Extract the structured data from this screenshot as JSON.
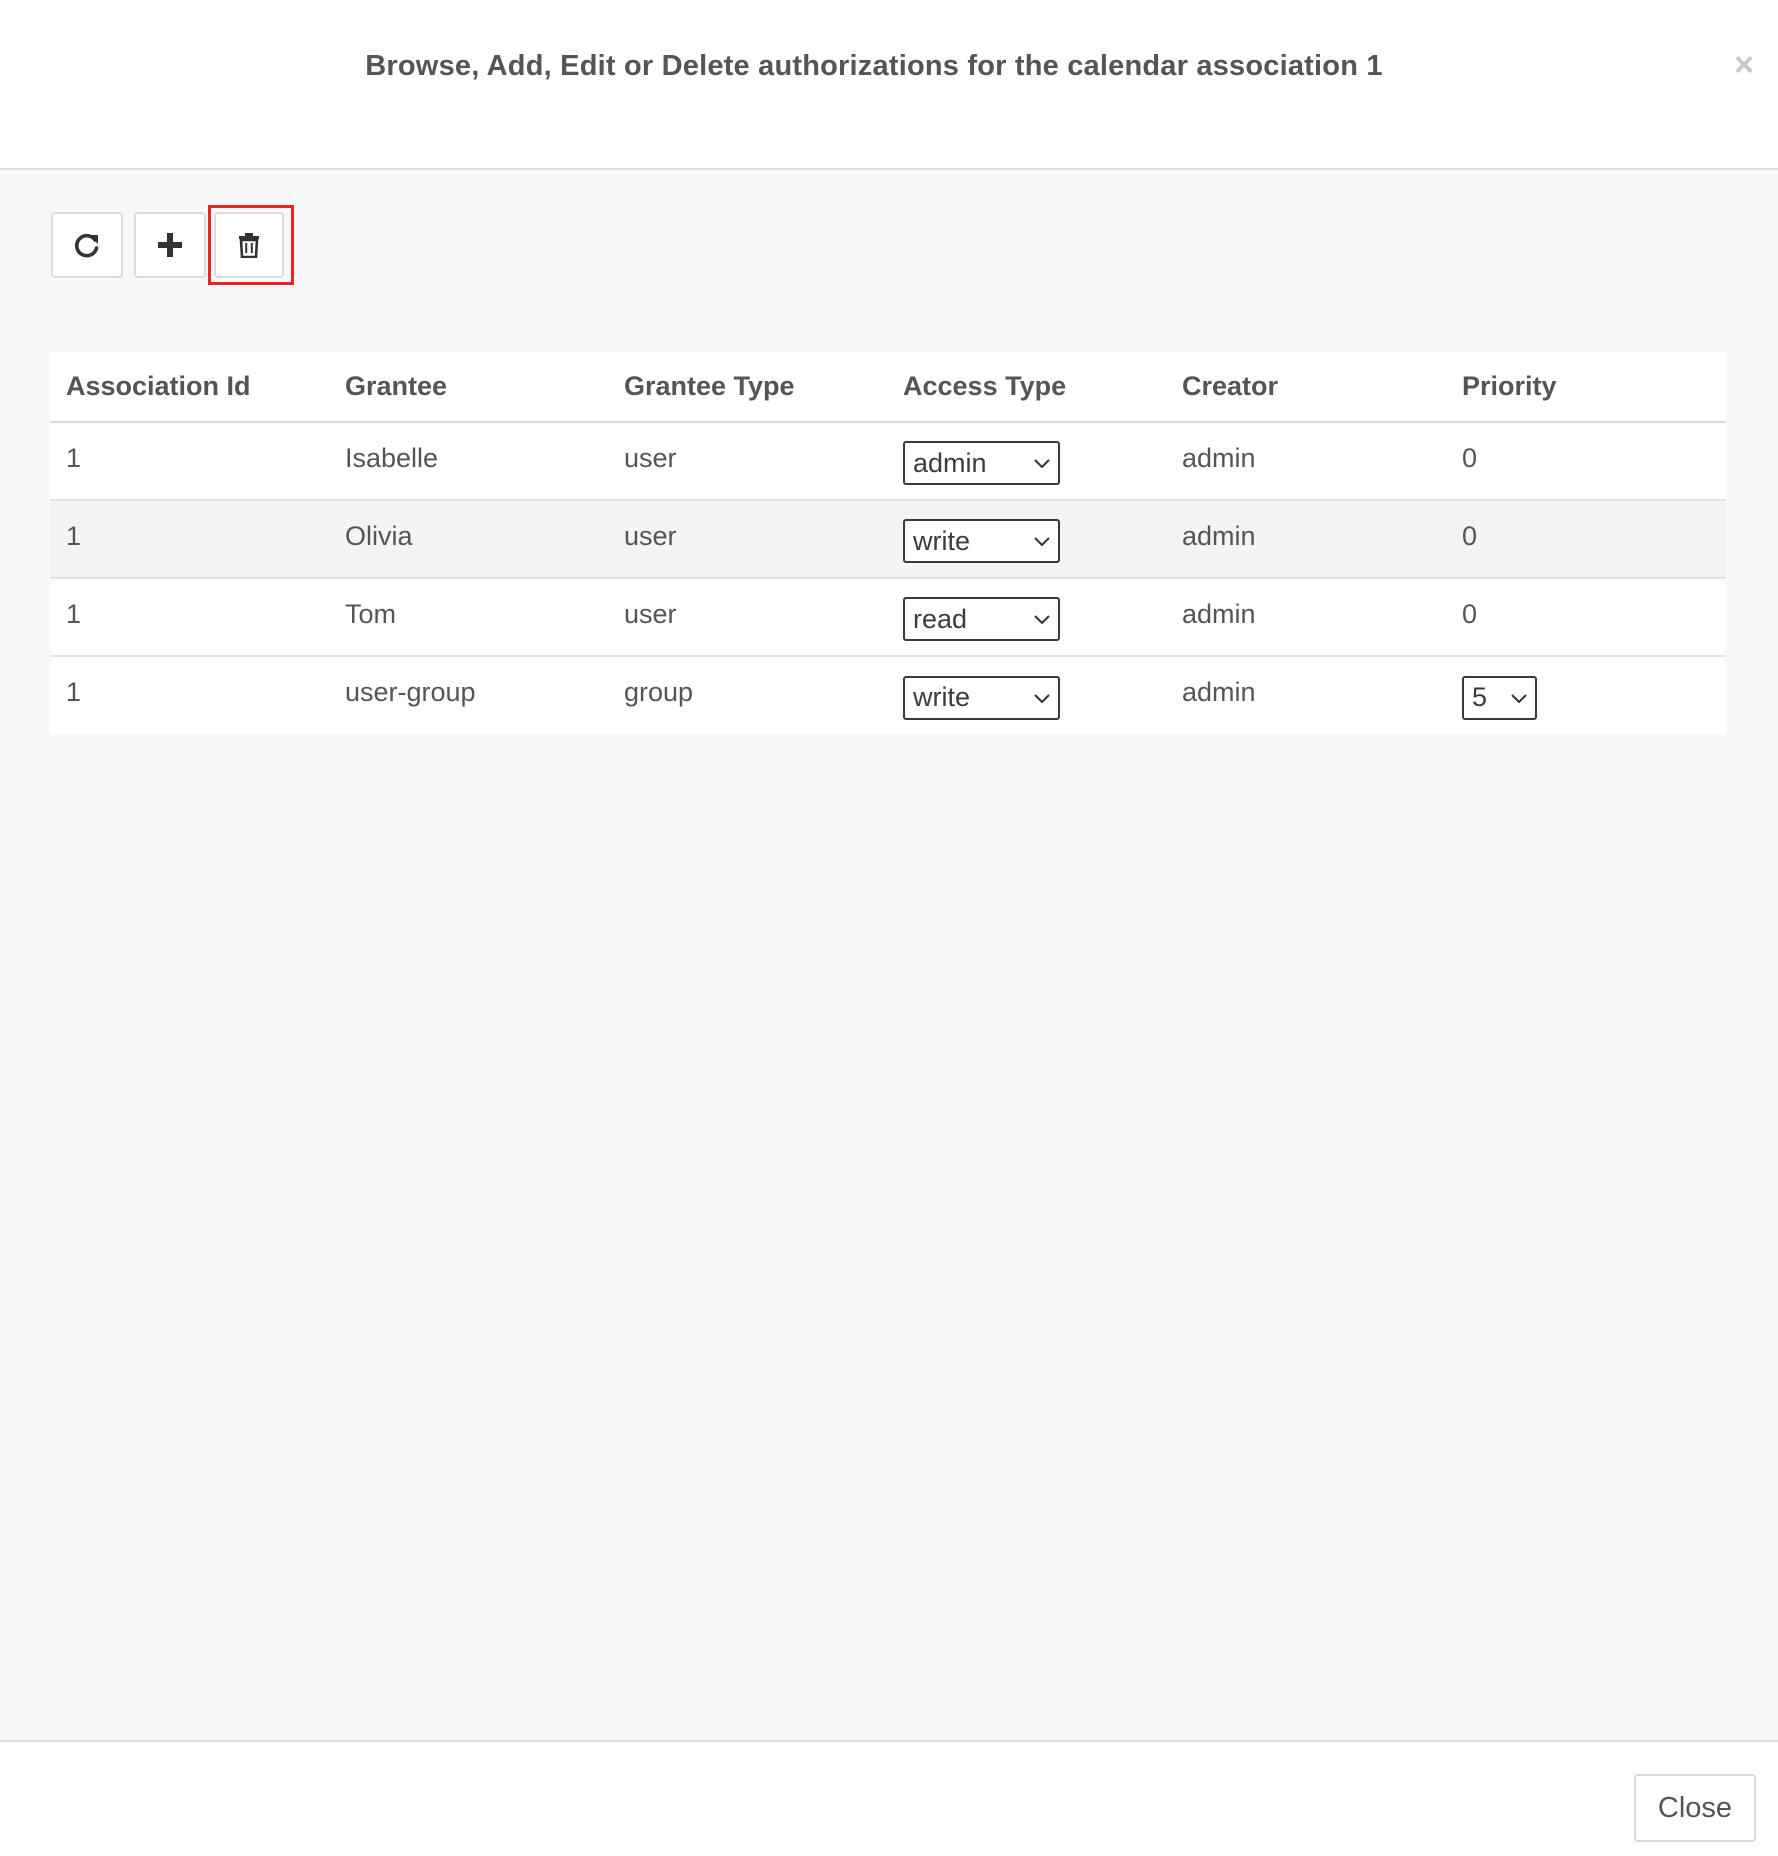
{
  "dialog": {
    "title": "Browse, Add, Edit or Delete authorizations for the calendar association 1",
    "close_glyph": "×"
  },
  "toolbar": {
    "buttons": [
      {
        "name": "refresh",
        "icon": "refresh-icon"
      },
      {
        "name": "add",
        "icon": "plus-icon"
      },
      {
        "name": "delete",
        "icon": "trash-icon",
        "highlighted": true
      }
    ]
  },
  "table": {
    "columns": [
      "Association Id",
      "Grantee",
      "Grantee Type",
      "Access Type",
      "Creator",
      "Priority"
    ],
    "rows": [
      {
        "association_id": "1",
        "grantee": "Isabelle",
        "grantee_type": "user",
        "access_type": "admin",
        "creator": "admin",
        "priority": "0"
      },
      {
        "association_id": "1",
        "grantee": "Olivia",
        "grantee_type": "user",
        "access_type": "write",
        "creator": "admin",
        "priority": "0"
      },
      {
        "association_id": "1",
        "grantee": "Tom",
        "grantee_type": "user",
        "access_type": "read",
        "creator": "admin",
        "priority": "0"
      },
      {
        "association_id": "1",
        "grantee": "user-group",
        "grantee_type": "group",
        "access_type": "write",
        "creator": "admin",
        "priority": "5"
      }
    ]
  },
  "footer": {
    "close_label": "Close"
  },
  "colors": {
    "highlight": "#e8281d",
    "background": "#f7f8fa",
    "text": "#555555"
  }
}
